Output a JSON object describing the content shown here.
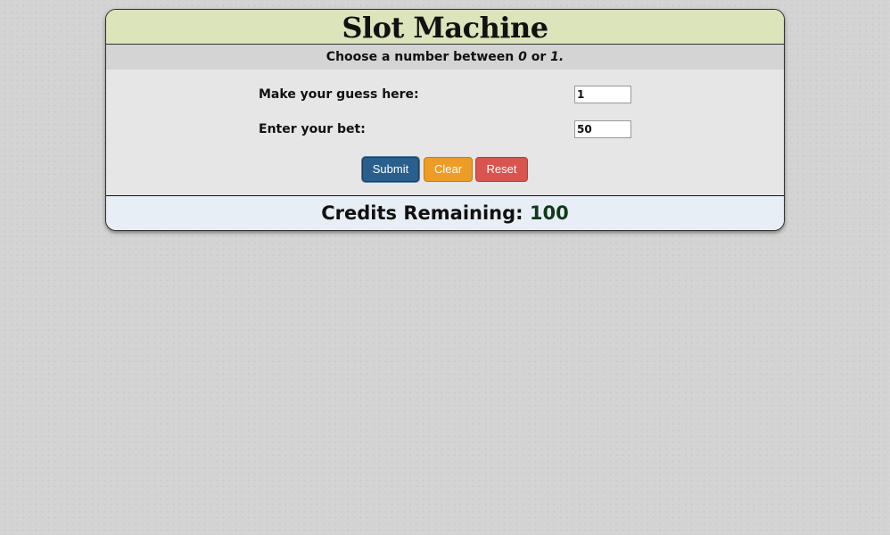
{
  "app": {
    "title": "Slot Machine",
    "subtitle": {
      "prefix": "Choose a number between ",
      "low": "0",
      "connector": " or ",
      "high": "1."
    }
  },
  "form": {
    "guess_label": "Make your guess here:",
    "guess_value": "1",
    "bet_label": "Enter your bet:",
    "bet_value": "50"
  },
  "buttons": {
    "submit": "Submit",
    "clear": "Clear",
    "reset": "Reset"
  },
  "credits": {
    "label": "Credits Remaining: ",
    "value": "100"
  },
  "colors": {
    "title_bg": "#dbe4bb",
    "submit": "#2a5f8d",
    "clear": "#ed9c28",
    "reset": "#d9534f",
    "credits_bg": "#e8eef6"
  }
}
